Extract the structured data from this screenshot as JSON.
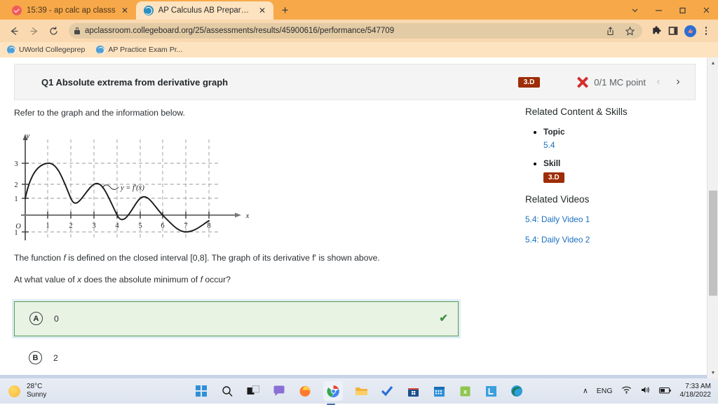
{
  "browser": {
    "tabs": [
      {
        "title": "15:39 - ap calc ap classs",
        "favicon": "red-check-icon",
        "active": false
      },
      {
        "title": "AP Calculus AB Preparation for A",
        "favicon": "globe-icon",
        "active": true
      }
    ],
    "new_tab_label": "+",
    "window_controls": {
      "minimize": "–",
      "maximize": "❐",
      "close": "✕",
      "chevron": "⌄"
    },
    "nav": {
      "back": "←",
      "forward": "→",
      "reload": "↻"
    },
    "url": "apclassroom.collegeboard.org/25/assessments/results/45900616/performance/547709",
    "bookmarks": [
      {
        "label": "UWorld Collegeprep"
      },
      {
        "label": "AP Practice Exam Pr..."
      }
    ]
  },
  "question_header": {
    "title": "Q1 Absolute extrema from derivative graph",
    "skill_badge": "3.D",
    "score": "0/1 MC point",
    "prev_arrow": "‹",
    "next_arrow": "›"
  },
  "stem": {
    "intro": "Refer to the graph and the information below.",
    "info_part1": "The function ",
    "info_f1": "f",
    "info_part2": " is defined on the closed interval [0,8]. The graph of its derivative f' is shown above.",
    "question_part1": "At what value of ",
    "question_x": "x",
    "question_part2": " does the absolute minimum of ",
    "question_f": "f",
    "question_part3": " occur?"
  },
  "chart_data": {
    "type": "line",
    "title": "",
    "xlabel": "x",
    "ylabel": "y",
    "origin_label": "O",
    "curve_label": "y = f'(x)",
    "xlim": [
      0,
      8.4
    ],
    "ylim": [
      -1.4,
      3.6
    ],
    "xticks": [
      1,
      2,
      3,
      4,
      5,
      6,
      7,
      8
    ],
    "yticks": [
      3,
      2,
      1,
      -1
    ],
    "grid": "dashed",
    "series": [
      {
        "name": "f'(x)",
        "points": [
          [
            0.0,
            1.0
          ],
          [
            0.25,
            1.95
          ],
          [
            0.5,
            2.55
          ],
          [
            0.75,
            2.9
          ],
          [
            1.0,
            3.0
          ],
          [
            1.25,
            2.88
          ],
          [
            1.5,
            2.45
          ],
          [
            1.75,
            1.7
          ],
          [
            2.0,
            1.0
          ],
          [
            2.25,
            1.05
          ],
          [
            2.5,
            1.35
          ],
          [
            2.75,
            1.75
          ],
          [
            3.0,
            2.0
          ],
          [
            3.25,
            1.92
          ],
          [
            3.5,
            1.45
          ],
          [
            3.75,
            0.7
          ],
          [
            4.0,
            0.02
          ],
          [
            4.25,
            0.05
          ],
          [
            4.5,
            0.35
          ],
          [
            4.75,
            0.75
          ],
          [
            5.0,
            1.0
          ],
          [
            5.25,
            0.95
          ],
          [
            5.5,
            0.72
          ],
          [
            5.75,
            0.38
          ],
          [
            6.0,
            0.0
          ],
          [
            6.25,
            -0.4
          ],
          [
            6.5,
            -0.72
          ],
          [
            6.75,
            -0.94
          ],
          [
            7.0,
            -1.0
          ],
          [
            7.25,
            -0.95
          ],
          [
            7.5,
            -0.8
          ],
          [
            7.75,
            -0.58
          ],
          [
            8.0,
            -0.35
          ]
        ]
      }
    ]
  },
  "choices": [
    {
      "letter": "A",
      "text": "0",
      "correct": true,
      "check": "✔"
    },
    {
      "letter": "B",
      "text": "2",
      "correct": false,
      "check": ""
    }
  ],
  "rail": {
    "related_content_title": "Related Content & Skills",
    "topic_term": "Topic",
    "topic_value": "5.4",
    "skill_term": "Skill",
    "skill_value": "3.D",
    "related_videos_title": "Related Videos",
    "videos": [
      {
        "label": "5.4: Daily Video 1"
      },
      {
        "label": "5.4: Daily Video 2"
      }
    ]
  },
  "taskbar": {
    "weather_temp": "28°C",
    "weather_cond": "Sunny",
    "time": "7:33 AM",
    "date": "4/18/2022",
    "language": "ENG",
    "chevron": "∧"
  }
}
